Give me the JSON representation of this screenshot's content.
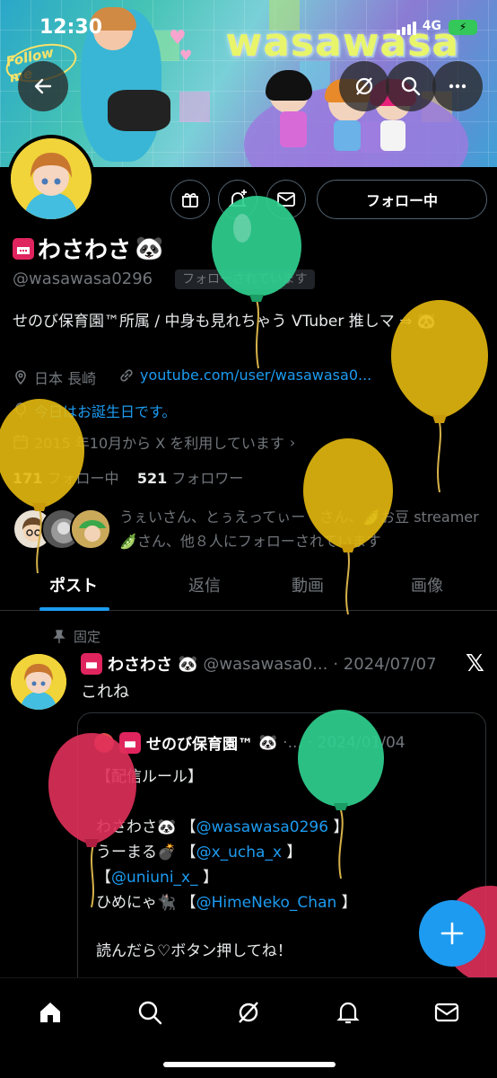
{
  "status_bar": {
    "time": "12:30",
    "network": "4G"
  },
  "banner": {
    "title": "wasawasa",
    "sticker": "Follow me"
  },
  "profile": {
    "name": "わさわさ",
    "handle": "@wasawasa0296",
    "follows_you": "フォローされています",
    "follow_button": "フォロー中",
    "bio": "せのび保育園™所属 / 中身も見れちゃう VTuber 推しマ ⇒ 🐼",
    "location": "日本 長崎",
    "website": "youtube.com/user/wasawasa0...",
    "birthday": "今日はお誕生日です。",
    "joined": "2015 年10月から X を利用しています",
    "following_count": "171",
    "following_label": "フォロー中",
    "followers_count": "521",
    "followers_label": "フォロワー",
    "followed_by": "うぇいさん、とぅえってぃー　さん、🫛お豆 streamer 🫛さん、他８人にフォローされています"
  },
  "tabs": [
    "ポスト",
    "返信",
    "動画",
    "画像"
  ],
  "post": {
    "pinned_label": "固定",
    "author_name": "わさわさ",
    "author_handle": "@wasawasa0...",
    "date": "· 2024/07/07",
    "text": "これね",
    "quote": {
      "author_name": "せのび保育園™",
      "author_handle": "·...",
      "date": "· 2024/01/04",
      "lines": [
        {
          "text": "【配信ルール】"
        },
        {
          "text": ""
        },
        {
          "text": "わさわさ🐼 【",
          "mention": "@wasawasa0296",
          "tail": " 】"
        },
        {
          "text": "うーまる💣 【",
          "mention": "@x_ucha_x",
          "tail": " 】"
        },
        {
          "text": "【",
          "mention": "@uniuni_x_",
          "tail": " 】"
        },
        {
          "text": "ひめにゃ🐈‍⬛ 【",
          "mention": "@HimeNeko_Chan",
          "tail": " 】"
        },
        {
          "text": ""
        },
        {
          "text": "読んだら♡ボタン押してね！"
        }
      ]
    }
  },
  "icons": {
    "back": "back-arrow-icon",
    "grok": "grok-icon",
    "search": "search-icon",
    "more": "more-icon",
    "gift": "gift-icon",
    "subscribe": "add-notification-icon",
    "message": "mail-icon",
    "location": "location-pin-icon",
    "link": "link-icon",
    "birthday": "balloon-icon",
    "calendar": "calendar-icon",
    "pin": "pin-icon",
    "compose": "plus-icon",
    "nav": [
      "home-icon",
      "search-icon",
      "grok-icon",
      "bell-icon",
      "mail-icon"
    ]
  },
  "colors": {
    "accent": "#1d9bf0",
    "background": "#000000",
    "muted": "#71767b"
  }
}
